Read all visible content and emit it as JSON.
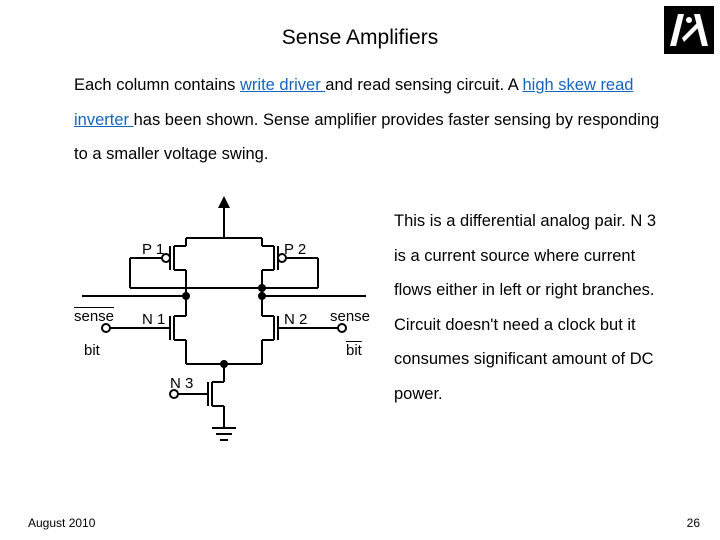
{
  "title": "Sense Amplifiers",
  "para1_a": "Each column contains ",
  "para1_link1": "write driver ",
  "para1_b": "and read sensing circuit. A ",
  "para1_link2": "high skew read inverter ",
  "para1_c": "has been shown. Sense amplifier provides faster sensing by responding to a smaller voltage swing.",
  "side": "This is a differential analog pair. N 3 is a current source where current flows either in left or right branches. Circuit doesn't need a clock but it consumes significant amount of DC power.",
  "labels": {
    "p1": "P 1",
    "p2": "P 2",
    "n1": "N 1",
    "n2": "N 2",
    "n3": "N 3",
    "sense": "sense",
    "bit": "bit"
  },
  "footer": {
    "date": "August 2010",
    "page": "26"
  }
}
